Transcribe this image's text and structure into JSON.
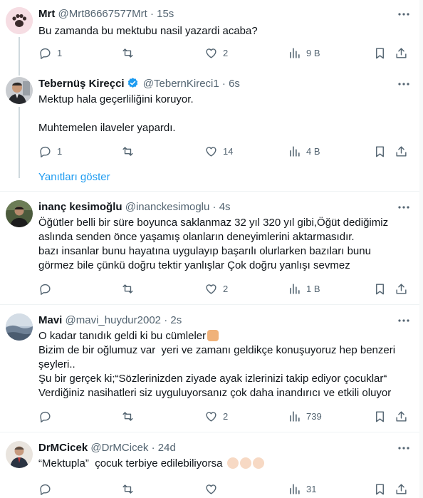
{
  "tweets": [
    {
      "name": "Mrt",
      "handle": "@Mrt86667577Mrt",
      "sep": "·",
      "time": "15s",
      "verified": false,
      "text": [
        "Bu zamanda bu mektubu nasil yazardi acaba?"
      ],
      "replies": "1",
      "retweets": "",
      "likes": "2",
      "views": "9 B"
    },
    {
      "name": "Tebernüş Kireçci",
      "handle": "@TebernKireci1",
      "sep": "·",
      "time": "6s",
      "verified": true,
      "text": [
        "Mektup hala geçerliliğini koruyor.",
        "",
        "Muhtemelen ilaveler yapardı."
      ],
      "replies": "1",
      "retweets": "",
      "likes": "14",
      "views": "4 B"
    },
    {
      "name": "inanç kesimoğlu",
      "handle": "@inanckesimoglu",
      "sep": "·",
      "time": "4s",
      "verified": false,
      "text": [
        "Öğütler belli bir süre boyunca saklanmaz 32 yıl 320 yıl gibi,Öğüt dediğimiz",
        "aslında senden önce yaşamış olanların deneyimlerini aktarmasıdır.",
        "bazı insanlar bunu hayatına uygulayıp başarılı olurlarken bazıları bunu",
        "görmez bile çünkü doğru tektir yanlışlar Çok doğru yanlışı sevmez"
      ],
      "replies": "",
      "retweets": "",
      "likes": "2",
      "views": "1 B"
    },
    {
      "name": "Mavi",
      "handle": "@mavi_huydur2002",
      "sep": "·",
      "time": "2s",
      "verified": false,
      "text": [
        "O kadar tanıdık geldi ki bu cümleler",
        "Bizim de bir oğlumuz var  yeri ve zamanı geldikçe konuşuyoruz hep benzeri",
        "şeyleri..",
        "Şu bir gerçek ki;“Sözlerinizden ziyade ayak izlerinizi takip ediyor çocuklar“",
        "Verdiğiniz nasihatleri siz uyguluyorsanız çok daha inandırıcı ve etkili oluyor"
      ],
      "replies": "",
      "retweets": "",
      "likes": "2",
      "views": "739"
    },
    {
      "name": "DrMCicek",
      "handle": "@DrMCicek",
      "sep": "·",
      "time": "24d",
      "verified": false,
      "text": [
        "“Mektupla”  çocuk terbiye edilebiliyorsa"
      ],
      "replies": "",
      "retweets": "",
      "likes": "",
      "views": "31"
    }
  ],
  "show_replies": "Yanıtları göster",
  "colors": {
    "text": "#0f1419",
    "secondary": "#536471",
    "accent": "#1d9bf0",
    "divider": "#eff3f4",
    "thread": "#cfd9de"
  }
}
